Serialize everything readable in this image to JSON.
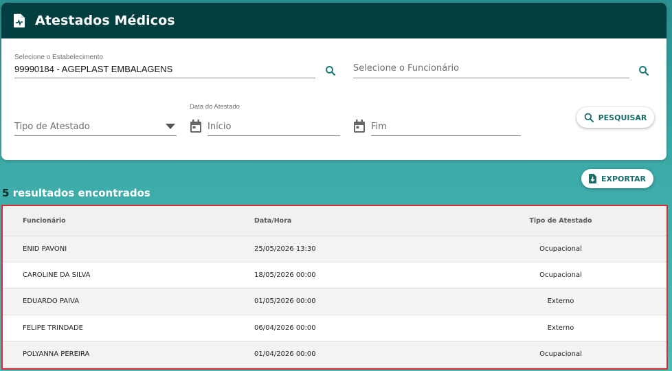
{
  "header": {
    "title": "Atestados Médicos",
    "icon": "medical-document-icon"
  },
  "filters": {
    "establishment": {
      "label": "Selecione o Estabelecimento",
      "value": "99990184 - AGEPLAST EMBALAGENS"
    },
    "employee": {
      "placeholder": "Selecione o Funcionário"
    },
    "certificate_type": {
      "placeholder": "Tipo de Atestado"
    },
    "date_label": "Data do Atestado",
    "start_date": {
      "placeholder": "Início"
    },
    "end_date": {
      "placeholder": "Fim"
    },
    "search_label": "PESQUISAR"
  },
  "actions": {
    "export_label": "EXPORTAR"
  },
  "results": {
    "count": "5",
    "suffix": " resultados encontrados",
    "columns": [
      "Funcionário",
      "Data/Hora",
      "Tipo de Atestado"
    ],
    "rows": [
      [
        "ENID PAVONI",
        "25/05/2026 13:30",
        "Ocupacional"
      ],
      [
        "CAROLINE DA SILVA",
        "18/05/2026 00:00",
        "Ocupacional"
      ],
      [
        "EDUARDO PAIVA",
        "01/05/2026 00:00",
        "Externo"
      ],
      [
        "FELIPE TRINDADE",
        "06/04/2026 00:00",
        "Externo"
      ],
      [
        "POLYANNA PEREIRA",
        "01/04/2026 00:00",
        "Ocupacional"
      ]
    ]
  },
  "colors": {
    "header_bg": "#033f40",
    "accent": "#1a7a78",
    "highlight_border": "#d62d35"
  }
}
